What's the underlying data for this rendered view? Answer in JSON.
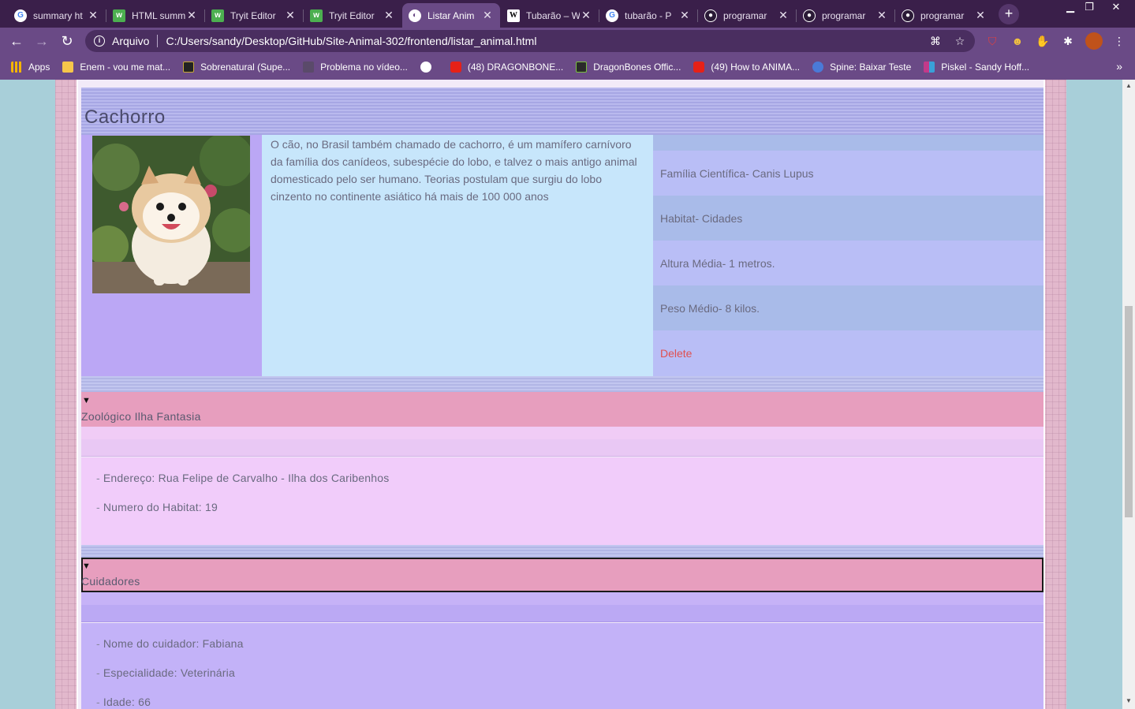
{
  "browser": {
    "tabs": [
      {
        "title": "summary ht",
        "icon": "google-icon",
        "active": false
      },
      {
        "title": "HTML summ",
        "icon": "w3schools-icon",
        "active": false
      },
      {
        "title": "Tryit Editor",
        "icon": "w3schools-icon",
        "active": false
      },
      {
        "title": "Tryit Editor",
        "icon": "w3schools-icon",
        "active": false
      },
      {
        "title": "Listar Anim",
        "icon": "globe-icon",
        "active": true
      },
      {
        "title": "Tubarão – W",
        "icon": "wikipedia-icon",
        "active": false
      },
      {
        "title": "tubarão - P",
        "icon": "google-icon",
        "active": false
      },
      {
        "title": "programar",
        "icon": "github-icon",
        "active": false
      },
      {
        "title": "programar",
        "icon": "github-icon",
        "active": false
      },
      {
        "title": "programar",
        "icon": "github-icon",
        "active": false
      }
    ],
    "address": {
      "scheme_label": "Arquivo",
      "url": "C:/Users/sandy/Desktop/GitHub/Site-Animal-302/frontend/listar_animal.html"
    },
    "bookmarks": [
      {
        "label": "Apps",
        "color": "#f4b400"
      },
      {
        "label": "Enem - vou me mat...",
        "color": "#f6c64a"
      },
      {
        "label": "Sobrenatural (Supe...",
        "color": "#222222"
      },
      {
        "label": "Problema no vídeo...",
        "color": "#5a4a6a"
      },
      {
        "label": "(48) DRAGONBONE...",
        "color": "#e62117"
      },
      {
        "label": "DragonBones Offic...",
        "color": "#2a2a2a"
      },
      {
        "label": "(49) How to ANIMA...",
        "color": "#e62117"
      },
      {
        "label": "Spine: Baixar Teste",
        "color": "#4a7ad8"
      },
      {
        "label": "Piskel - Sandy Hoff...",
        "color": "#c23a8a"
      }
    ]
  },
  "animal": {
    "name": "Cachorro",
    "description": "O cão, no Brasil também chamado de cachorro, é um mamífero carnívoro da família dos canídeos, subespécie do lobo, e talvez o mais antigo animal domesticado pelo ser humano. Teorias postulam que surgiu do lobo cinzento no continente asiático há mais de 100 000 anos",
    "info": {
      "familia": "Família Científica- Canis Lupus",
      "habitat": "Habitat- Cidades",
      "altura": "Altura Média- 1 metros.",
      "peso": "Peso Médio- 8 kilos.",
      "delete_label": "Delete"
    }
  },
  "zoo": {
    "summary": "Zoológico Ilha Fantasia",
    "endereco": "Endereço: Rua Felipe de Carvalho - Ilha dos Caribenhos",
    "habitat_num": "Numero do Habitat: 19"
  },
  "cuidadores": {
    "summary": "Cuidadores",
    "nome": "Nome do cuidador: Fabiana",
    "especialidade": "Especialidade: Veterinária",
    "idade": "Idade: 66"
  },
  "colors": {
    "tab_bar": "#3a1f4a",
    "toolbar": "#6a4a86",
    "delete": "#e05050",
    "summary_pink": "#e79ebe",
    "info_blue": "#b9bef6",
    "desc_blue": "#c7e6fb"
  }
}
